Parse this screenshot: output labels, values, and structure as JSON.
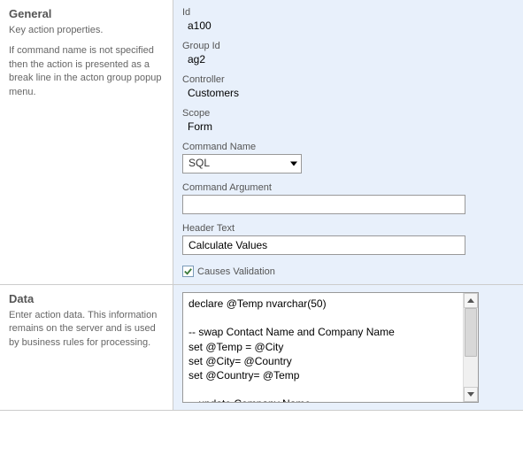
{
  "general": {
    "title": "General",
    "desc1": "Key action properties.",
    "desc2": "If command name is not specified then the action is presented as a break line in the acton group popup menu.",
    "id_label": "Id",
    "id_value": "a100",
    "group_id_label": "Group Id",
    "group_id_value": "ag2",
    "controller_label": "Controller",
    "controller_value": "Customers",
    "scope_label": "Scope",
    "scope_value": "Form",
    "command_name_label": "Command Name",
    "command_name_value": "SQL",
    "command_argument_label": "Command Argument",
    "command_argument_value": "",
    "header_text_label": "Header Text",
    "header_text_value": "Calculate Values",
    "causes_validation_label": "Causes Validation",
    "causes_validation_checked": true
  },
  "data": {
    "title": "Data",
    "desc": "Enter action data. This information remains on the server and is used by business rules for processing.",
    "value": "declare @Temp nvarchar(50)\n\n-- swap Contact Name and Company Name\nset @Temp = @City\nset @City= @Country\nset @Country= @Temp\n\n-- update Company Name\nselect @CompanyName = @CompanyName + ': ' + City"
  }
}
